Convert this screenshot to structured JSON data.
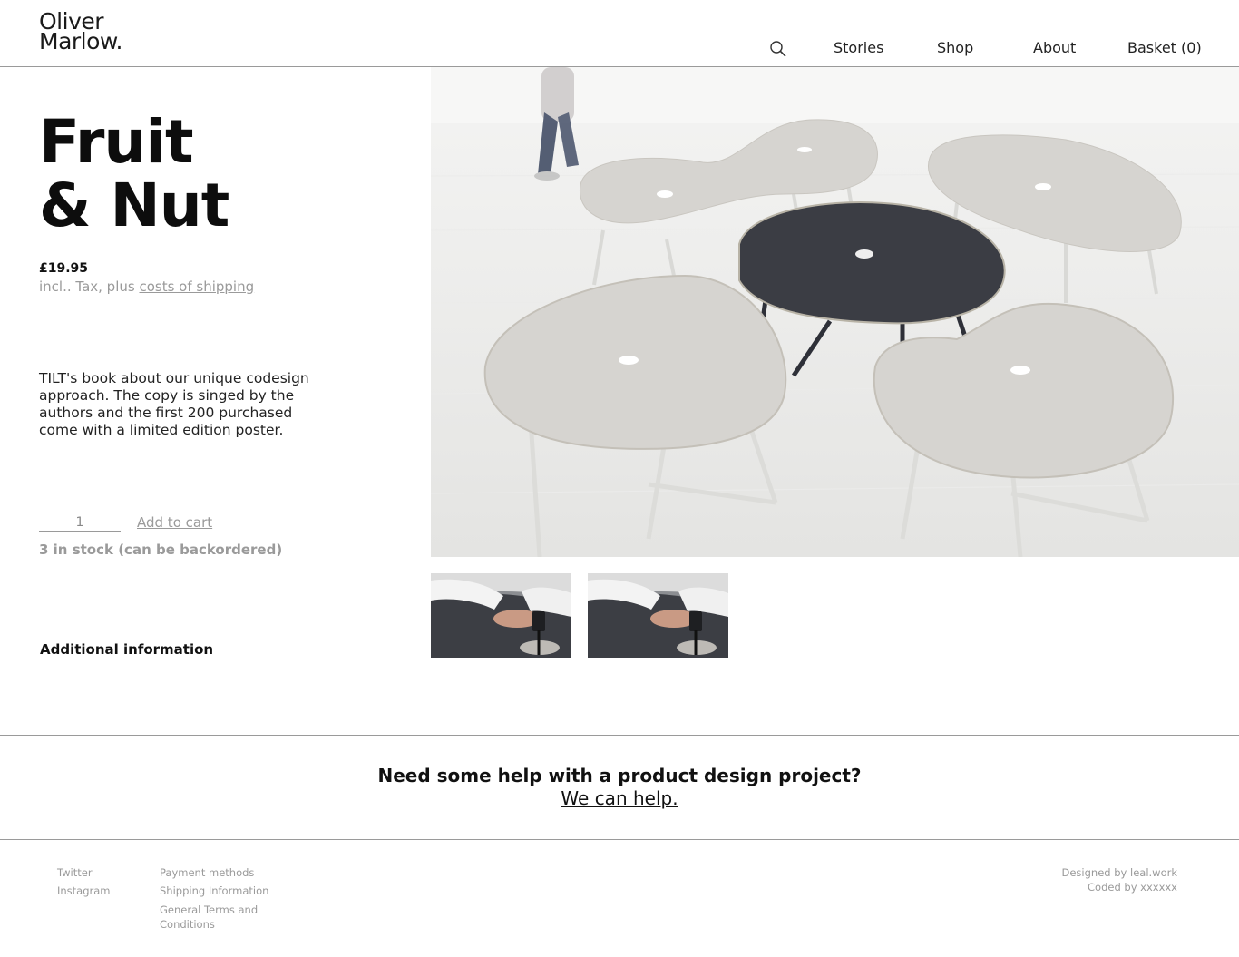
{
  "brand": {
    "line1": "Oliver",
    "line2": "Marlow."
  },
  "nav": {
    "stories": "Stories",
    "shop": "Shop",
    "about": "About",
    "basket": "Basket (0)"
  },
  "product": {
    "title_line1": "Fruit",
    "title_line2": "& Nut",
    "price": "£19.95",
    "tax_prefix": "incl.. Tax, plus ",
    "tax_link": "costs of shipping",
    "description": "TILT's book about our unique codesign approach. The copy is singed by the authors and the first 200 purchased come with a limited edition poster.",
    "quantity": "1",
    "add_to_cart": "Add to cart",
    "stock": "3 in stock (can be backordered)",
    "additional_info": "Additional information"
  },
  "cta": {
    "question": "Need some help with a product design project?",
    "link": "We can help."
  },
  "footer": {
    "twitter": "Twitter",
    "instagram": "Instagram",
    "payment": "Payment methods",
    "shipping": "Shipping Information",
    "terms": "General Terms and Conditions",
    "designed": "Designed by leal.work",
    "coded": "Coded by xxxxxx"
  },
  "colors": {
    "text": "#111111",
    "muted": "#9a9a9a",
    "rule": "#9a9a9a",
    "floor": "#e9e9e7",
    "table_light": "#dcdad6",
    "table_dark": "#3b3d44"
  }
}
